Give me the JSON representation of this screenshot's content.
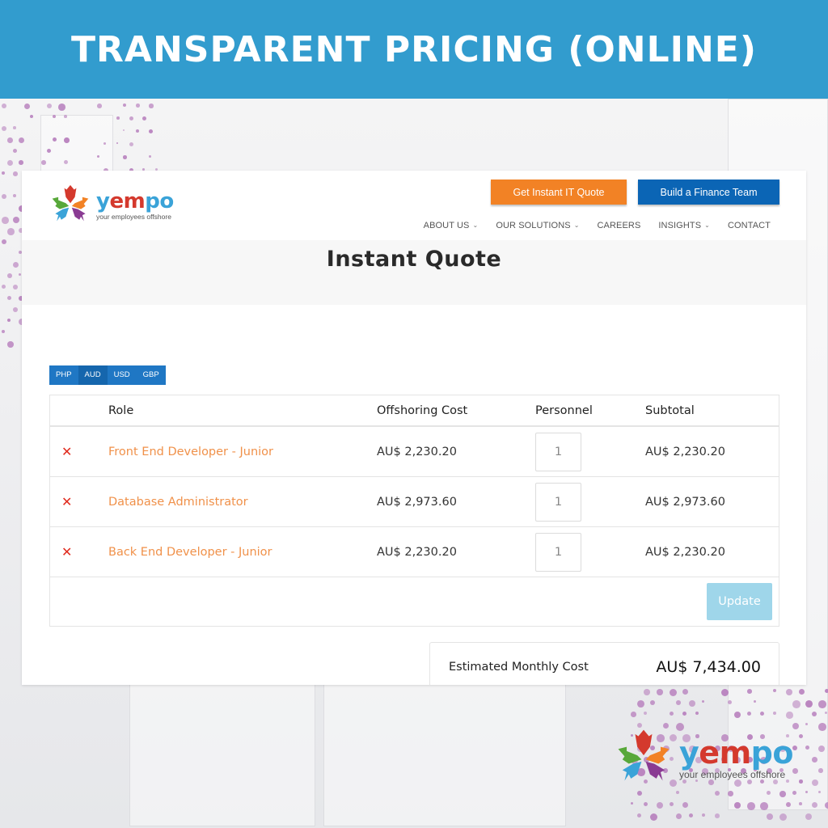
{
  "banner": {
    "title": "TRANSPARENT PRICING (ONLINE)"
  },
  "colors": {
    "banner_bg": "#329cce",
    "orange_button": "#f28225",
    "blue_button": "#0b65b5",
    "role_link": "#f0914a",
    "remove_x": "#e02b1e",
    "update_button": "#9fd6ea",
    "currency_bar": "#1f77c4"
  },
  "site": {
    "logo": {
      "word": [
        "y",
        "e",
        "m",
        "p",
        "o"
      ],
      "tagline": "your employees offshore",
      "icon": "yempo-flower-logo-icon"
    },
    "header_buttons": {
      "it_quote": "Get Instant IT Quote",
      "finance_team": "Build a Finance Team"
    },
    "nav": [
      {
        "label": "ABOUT US",
        "dropdown": true
      },
      {
        "label": "OUR SOLUTIONS",
        "dropdown": true
      },
      {
        "label": "CAREERS",
        "dropdown": false
      },
      {
        "label": "INSIGHTS",
        "dropdown": true
      },
      {
        "label": "CONTACT",
        "dropdown": false
      }
    ],
    "chevron": "⌄",
    "page_title": "Instant Quote",
    "currencies": [
      {
        "label": "PHP",
        "active": false
      },
      {
        "label": "AUD",
        "active": true
      },
      {
        "label": "USD",
        "active": false
      },
      {
        "label": "GBP",
        "active": false
      }
    ],
    "table": {
      "headers": {
        "role": "Role",
        "cost": "Offshoring Cost",
        "personnel": "Personnel",
        "subtotal": "Subtotal"
      },
      "remove_glyph": "✕",
      "rows": [
        {
          "role": "Front End Developer - Junior",
          "cost": "AU$  2,230.20",
          "personnel": "1",
          "subtotal": "AU$  2,230.20"
        },
        {
          "role": "Database Administrator",
          "cost": "AU$  2,973.60",
          "personnel": "1",
          "subtotal": "AU$  2,973.60"
        },
        {
          "role": "Back End Developer - Junior",
          "cost": "AU$  2,230.20",
          "personnel": "1",
          "subtotal": "AU$  2,230.20"
        }
      ],
      "update_label": "Update"
    },
    "total": {
      "label": "Estimated Monthly Cost",
      "value": "AU$  7,434.00"
    }
  },
  "brand_footer": {
    "word": [
      "y",
      "e",
      "m",
      "p",
      "o"
    ],
    "tagline": "your employees offshore"
  }
}
